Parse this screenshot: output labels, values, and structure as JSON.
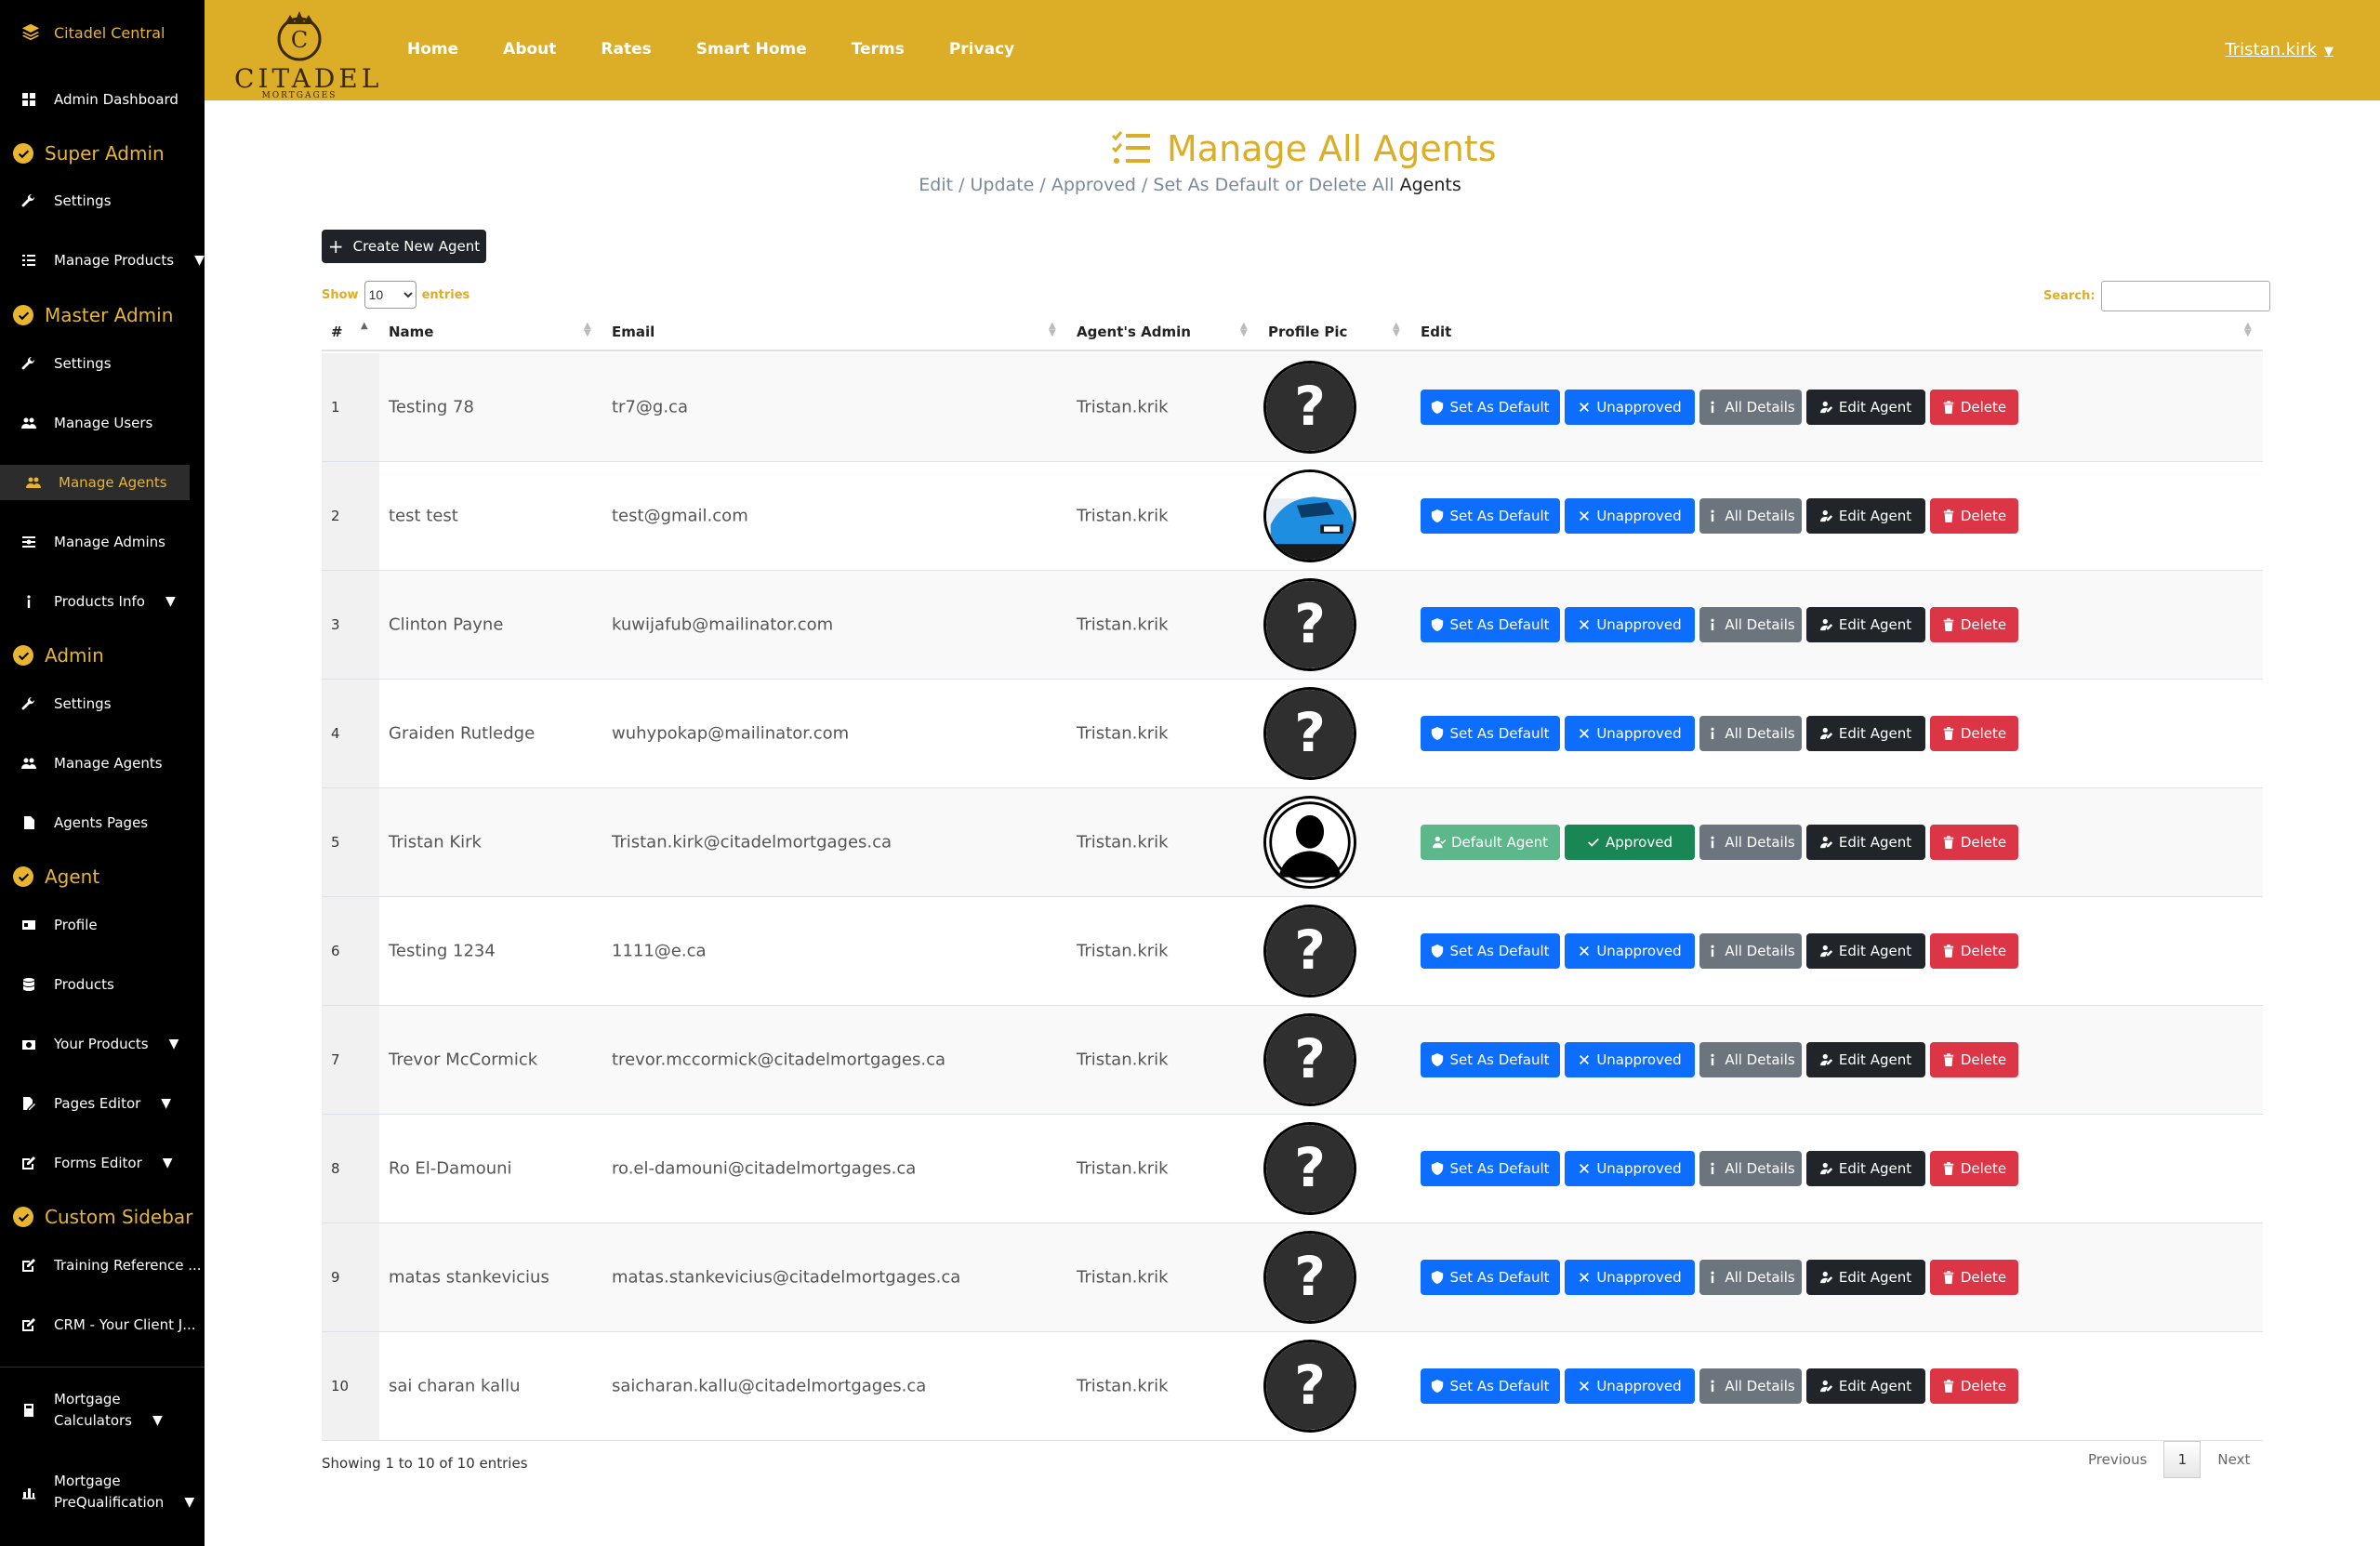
{
  "sidebar": {
    "brand": "Citadel Central",
    "items": [
      {
        "label": "Admin Dashboard"
      },
      {
        "section": "Super Admin"
      },
      {
        "label": "Settings"
      },
      {
        "label": "Manage Products"
      },
      {
        "section": "Master Admin"
      },
      {
        "label": "Settings"
      },
      {
        "label": "Manage Users"
      },
      {
        "label": "Manage Agents"
      },
      {
        "label": "Manage Admins"
      },
      {
        "label": "Products Info"
      },
      {
        "section": "Admin"
      },
      {
        "label": "Settings"
      },
      {
        "label": "Manage Agents"
      },
      {
        "label": "Agents Pages"
      },
      {
        "section": "Agent"
      },
      {
        "label": "Profile"
      },
      {
        "label": "Products"
      },
      {
        "label": "Your Products"
      },
      {
        "label": "Pages Editor"
      },
      {
        "label": "Forms Editor"
      },
      {
        "section": "Custom Sidebar"
      },
      {
        "label": "Training Reference ..."
      },
      {
        "label": "CRM - Your Client J..."
      },
      {
        "label_line1": "Mortgage",
        "label_line2": "Calculators"
      },
      {
        "label_line1": "Mortgage",
        "label_line2": "PreQualification"
      }
    ]
  },
  "header": {
    "logo_text": "CITADEL",
    "logo_sub": "MORTGAGES",
    "nav": [
      "Home",
      "About",
      "Rates",
      "Smart Home",
      "Terms",
      "Privacy"
    ],
    "user": "Tristan.kirk"
  },
  "page": {
    "title": "Manage All Agents",
    "subtitle_prefix": "Edit / Update / Approved / Set As Default or Delete All",
    "subtitle_emph": "Agents",
    "create_button": "Create New Agent",
    "show_label": "Show",
    "entries_label": "entries",
    "page_length": "10",
    "search_label": "Search:",
    "search_value": ""
  },
  "table": {
    "columns": [
      "#",
      "Name",
      "Email",
      "Agent's Admin",
      "Profile Pic",
      "Edit"
    ],
    "actions": {
      "set_default": "Set As Default",
      "default_agent": "Default Agent",
      "unapproved": "Unapproved",
      "approved": "Approved",
      "details": "All Details",
      "edit": "Edit Agent",
      "delete": "Delete"
    },
    "rows": [
      {
        "num": "1",
        "name": "Testing 78",
        "email": "tr7@g.ca",
        "admin": "Tristan.krik",
        "pic": "placeholder",
        "is_default": false,
        "approved": false
      },
      {
        "num": "2",
        "name": "test test",
        "email": "test@gmail.com",
        "admin": "Tristan.krik",
        "pic": "car-photo",
        "is_default": false,
        "approved": false
      },
      {
        "num": "3",
        "name": "Clinton Payne",
        "email": "kuwijafub@mailinator.com",
        "admin": "Tristan.krik",
        "pic": "placeholder",
        "is_default": false,
        "approved": false
      },
      {
        "num": "4",
        "name": "Graiden Rutledge",
        "email": "wuhypokap@mailinator.com",
        "admin": "Tristan.krik",
        "pic": "placeholder",
        "is_default": false,
        "approved": false
      },
      {
        "num": "5",
        "name": "Tristan Kirk",
        "email": "Tristan.kirk@citadelmortgages.ca",
        "admin": "Tristan.krik",
        "pic": "person-silhouette",
        "is_default": true,
        "approved": true
      },
      {
        "num": "6",
        "name": "Testing 1234",
        "email": "1111@e.ca",
        "admin": "Tristan.krik",
        "pic": "placeholder",
        "is_default": false,
        "approved": false
      },
      {
        "num": "7",
        "name": "Trevor McCormick",
        "email": "trevor.mccormick@citadelmortgages.ca",
        "admin": "Tristan.krik",
        "pic": "placeholder",
        "is_default": false,
        "approved": false
      },
      {
        "num": "8",
        "name": "Ro El-Damouni",
        "email": "ro.el-damouni@citadelmortgages.ca",
        "admin": "Tristan.krik",
        "pic": "placeholder",
        "is_default": false,
        "approved": false
      },
      {
        "num": "9",
        "name": "matas stankevicius",
        "email": "matas.stankevicius@citadelmortgages.ca",
        "admin": "Tristan.krik",
        "pic": "placeholder",
        "is_default": false,
        "approved": false
      },
      {
        "num": "10",
        "name": "sai charan kallu",
        "email": "saicharan.kallu@citadelmortgages.ca",
        "admin": "Tristan.krik",
        "pic": "placeholder",
        "is_default": false,
        "approved": false
      }
    ]
  },
  "footer": {
    "info": "Showing 1 to 10 of 10 entries",
    "previous": "Previous",
    "current_page": "1",
    "next": "Next"
  },
  "colors": {
    "brand_gold": "#dcad26",
    "sidebar_bg": "#000000",
    "primary": "#0d6efd",
    "success": "#198754",
    "danger": "#dc3545",
    "secondary": "#6c757d",
    "dark": "#212529"
  }
}
